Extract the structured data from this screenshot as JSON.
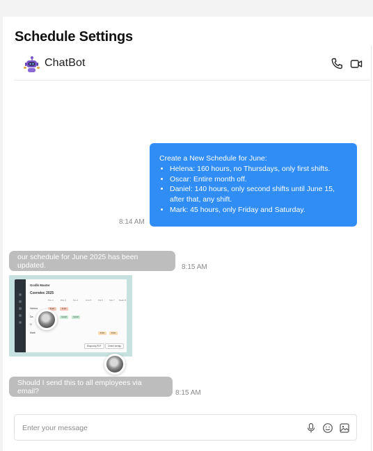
{
  "page": {
    "title": "Schedule Settings"
  },
  "header": {
    "bot_name": "ChatBot",
    "icons": [
      "robot-avatar-icon",
      "phone-icon",
      "video-icon"
    ]
  },
  "messages": {
    "outgoing": {
      "intro": "Create a New Schedule for June:",
      "items": [
        "Helena: 160 hours, no Thursdays, only first shifts.",
        "Oscar: Entire month off.",
        "Daniel: 140 hours, only second shifts until June 15, after that, any shift.",
        "Mark: 45 hours, only Friday and Saturday."
      ],
      "time": "8:14 AM"
    },
    "incoming_1": {
      "text": "our schedule for June 2025 has been updated.",
      "time": "8:15 AM"
    },
    "image": {
      "app_title": "Grafik Master",
      "month": "Czerwiec 2025",
      "days": [
        "Pon 2",
        "Wto 3",
        "Śro 4",
        "Czw 5",
        "Ptk 6",
        "Sob 7",
        "Niedz 8"
      ],
      "rows": [
        "Helena",
        "Da",
        "O",
        "Mark"
      ],
      "shift_label": "8-16",
      "shift_label_2": "14-22",
      "buttons": [
        "Eksportuj PDF",
        "Zmień wersję"
      ]
    },
    "incoming_2": {
      "text": "Should I send this to all employees via email?",
      "time": "8:15 AM"
    }
  },
  "composer": {
    "placeholder": "Enter your message",
    "icons": [
      "microphone-icon",
      "emoji-icon",
      "image-icon"
    ]
  },
  "colors": {
    "accent": "#2f8df5",
    "incoming_bubble": "#bdbdbd",
    "image_background": "#c6e1df",
    "bot_purple": "#7a55c9"
  }
}
